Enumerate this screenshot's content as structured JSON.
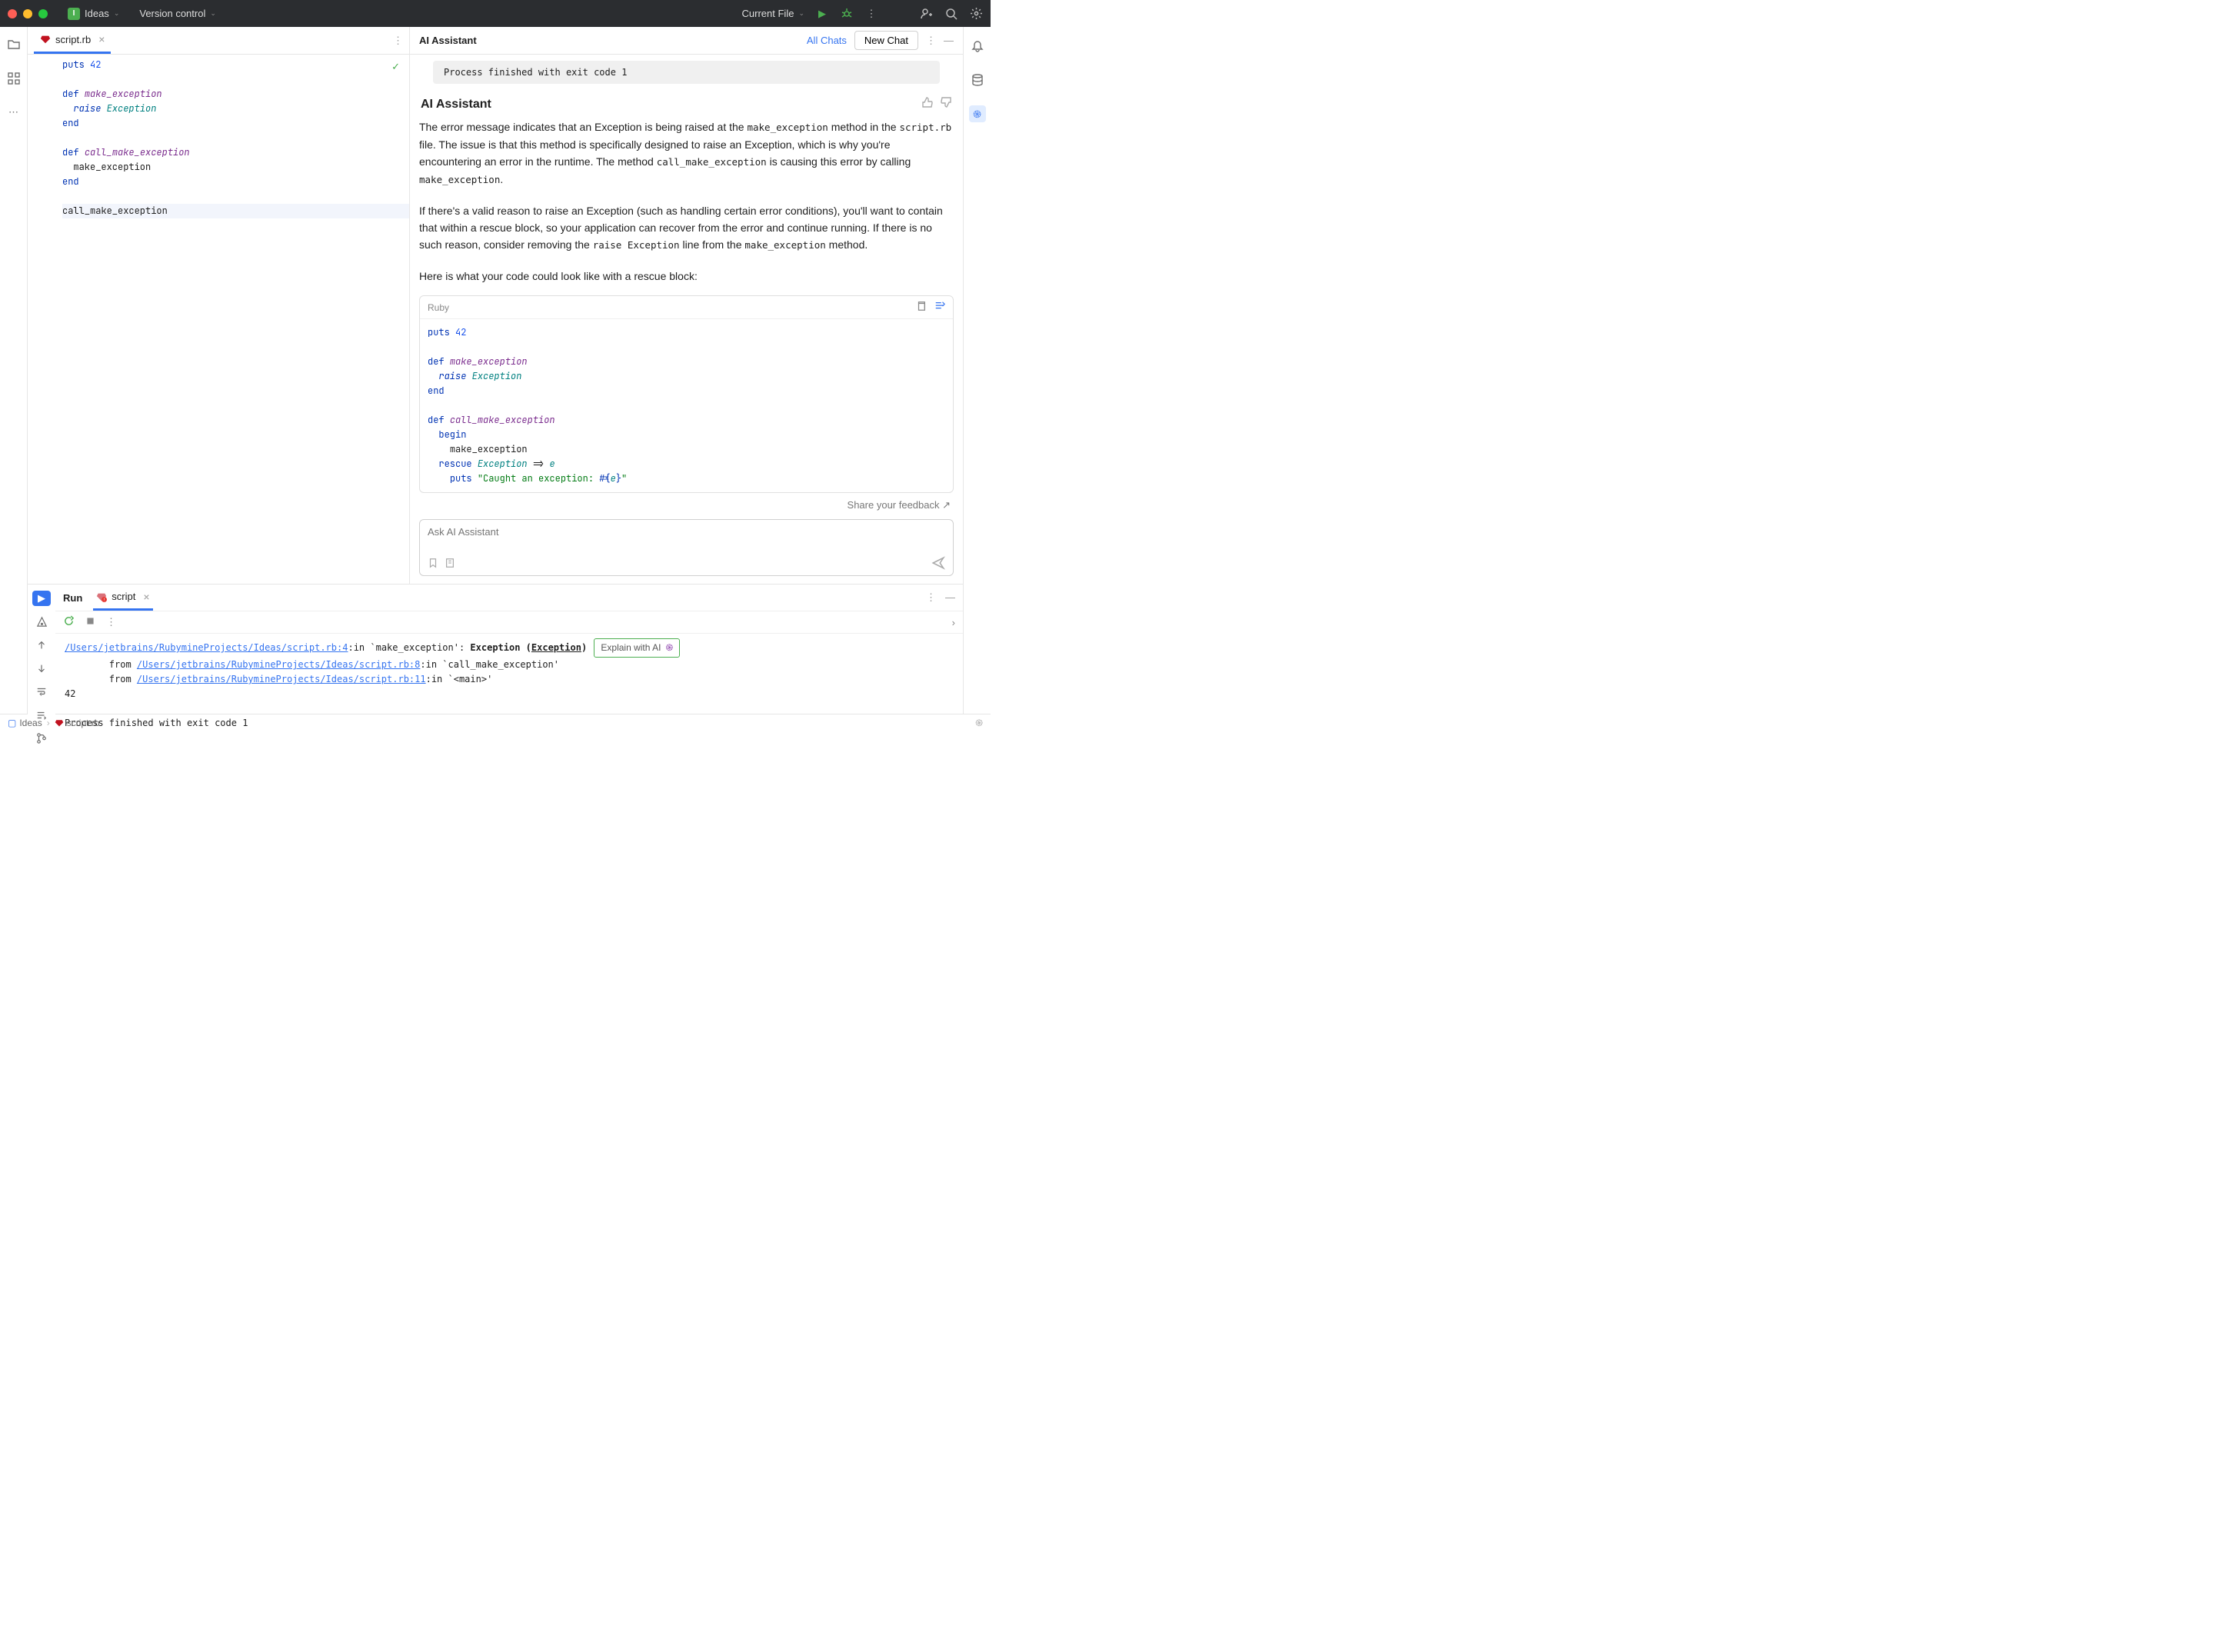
{
  "titlebar": {
    "project": "Ideas",
    "vcs": "Version control",
    "run_config": "Current File"
  },
  "editor": {
    "tab_filename": "script.rb",
    "puts": "puts",
    "def": "def",
    "raise": "raise",
    "end": "end",
    "literal42": "42",
    "make_exception": "make_exception",
    "exception_cls": "Exception",
    "call_make_exception": "call_make_exception",
    "call_stmt": "call_make_exception",
    "make_stmt": "make_exception"
  },
  "ai": {
    "title": "AI Assistant",
    "all_chats": "All Chats",
    "new_chat": "New Chat",
    "process_finished": "Process finished with exit code 1",
    "msg_title": "AI Assistant",
    "p1a": "The error message indicates that an Exception is being raised at the ",
    "p1b": " method in the ",
    "p1c": " file. The issue is that this method is specifically designed to raise an Exception, which is why you're encountering an error in the runtime. The method ",
    "p1d": " is causing this error by calling ",
    "p1e": ".",
    "mono1": "make_exception",
    "mono2": "script.rb",
    "mono3": "call_make_exception",
    "mono4": "make_exception",
    "p2a": "If there's a valid reason to raise an Exception (such as handling certain error conditions), you'll want to contain that within a rescue block, so your application can recover from the error and continue running. If there is no such reason, consider removing the ",
    "p2b": " line from the ",
    "p2c": " method.",
    "mono5": "raise Exception",
    "mono6": "make_exception",
    "p3": "Here is what your code could look like with a rescue block:",
    "code_lang": "Ruby",
    "code": {
      "puts": "puts",
      "l42": "42",
      "def": "def",
      "make_exception": "make_exception",
      "raise": "raise",
      "exception": "Exception",
      "end": "end",
      "call_make_exception": "call_make_exception",
      "begin": "begin",
      "rescue": "rescue",
      "arrow": " => ",
      "e": "e",
      "str_prefix": "\"Caught an exception: ",
      "interp_open": "#{",
      "interp_close": "}",
      "str_suffix": "\""
    },
    "feedback": "Share your feedback ↗",
    "input_placeholder": "Ask AI Assistant"
  },
  "run": {
    "title": "Run",
    "tab_name": "script",
    "path1": "/Users/jetbrains/RubymineProjects/Ideas/script.rb:4",
    "trace1a": ":in `make_exception': ",
    "trace1b": "Exception (",
    "trace1c": "Exception",
    "trace1d": ")",
    "explain": "Explain with AI",
    "from_prefix": "        from ",
    "path2": "/Users/jetbrains/RubymineProjects/Ideas/script.rb:8",
    "trace2": ":in `call_make_exception'",
    "path3": "/Users/jetbrains/RubymineProjects/Ideas/script.rb:11",
    "trace3": ":in `<main>'",
    "out42": "42",
    "finished": "Process finished with exit code 1"
  },
  "status": {
    "project": "Ideas",
    "file": "script.rb"
  }
}
